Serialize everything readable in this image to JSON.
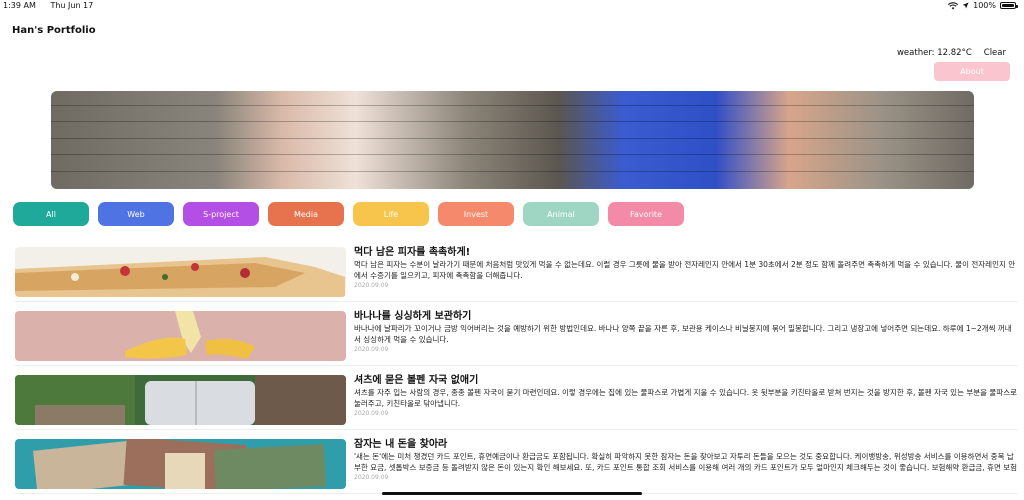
{
  "status_bar": {
    "time": "1:39 AM",
    "date": "Thu Jun 17",
    "battery": "100%",
    "battery_level": 1.0
  },
  "header": {
    "title": "Han's Portfolio"
  },
  "weather": {
    "text": "weather: 12.82°C",
    "condition": "Clear"
  },
  "about_button": {
    "label": "About"
  },
  "categories": [
    {
      "label": "All",
      "color": "#1fa99a"
    },
    {
      "label": "Web",
      "color": "#4f73e3"
    },
    {
      "label": "S-project",
      "color": "#b44fe6"
    },
    {
      "label": "Media",
      "color": "#e6734d"
    },
    {
      "label": "Life",
      "color": "#f7c54c"
    },
    {
      "label": "Invest",
      "color": "#f48a6b"
    },
    {
      "label": "Animal",
      "color": "#9fd6c3"
    },
    {
      "label": "Favorite",
      "color": "#f38aa7"
    }
  ],
  "posts": [
    {
      "title": "먹다 남은 피자를 촉촉하게!",
      "summary": "먹다 남은 피자는 수분이 날라가기 때문에 처음처럼 맛있게 먹을 수 없는데요. 이럴 경우 그릇에 물을 받아 전자레인지 안에서 1분 30초에서 2분 정도 함께 돌려주면 촉촉하게 먹을 수 있습니다. 물이 전자레인지 안에서 수증기를 일으키고, 피자에 촉촉함을 더해줍니다.",
      "date": "2020.09.09"
    },
    {
      "title": "바나나를 싱싱하게 보관하기",
      "summary": "바나나에 날파리가 꼬이거나 금방 익어버리는 것을 예방하기 위한 방법인데요. 바나나 양쪽 끝을 자른 후, 보관용 케이스나 비닐봉지에 묶어 밀봉합니다. 그리고 냉장고에 넣어주면 되는데요. 하루에 1~2개씩 꺼내서 싱싱하게 먹을 수 있습니다.",
      "date": "2020.09.09"
    },
    {
      "title": "셔츠에 묻은 볼펜 자국 없애기",
      "summary": "셔츠를 자주 입는 사람의 경우, 종종 볼펜 자국이 묻기 마련인데요. 이렇 경우에는 집에 있는 물파스로 가볍게 지울 수 있습니다. 옷 뒷부분을 키친타올로 받쳐 번지는 것을 방지한 후, 볼펜 자국 있는 부분을 물파스로 눌러주고, 키친타올로 닦아냅니다.",
      "date": "2020.09.09"
    },
    {
      "title": "잠자는 내 돈을 찾아라",
      "summary": "'새는 돈'에는 미처 챙겼던 카드 포인트, 휴면예금이나 환급금도 포함됩니다. 확실히 파악하지 못한 잠자는 돈을 찾아보고 자투리 돈들을 모으는 것도 중요합니다. 케이뱅방송, 위성방송 서비스를 이용하면서 중복 납부한 요금, 셋톱박스 보증금 등 돌려받지 않은 돈이 있는지 확인 해보세요. 또, 카드 포인트 통합 조회 서비스를 이용해 여러 개의 카드 포인트가 모두 얼마인지 체크해두는 것이 좋습니다. 보험해약 환급금, 휴면 보험금이나 휴면 예금을 찾아보",
      "date": "2020.09.09"
    }
  ]
}
